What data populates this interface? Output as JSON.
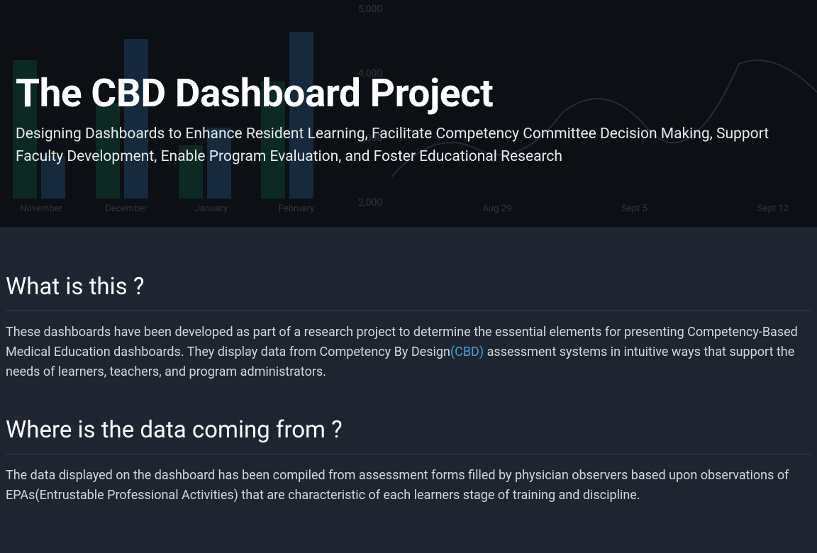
{
  "hero": {
    "title": "The CBD Dashboard Project",
    "subtitle": "Designing Dashboards to Enhance Resident Learning, Facilitate Competency Committee Decision Making, Support Faculty Development, Enable Program Evaluation, and Foster Educational Research"
  },
  "bgChart": {
    "months": [
      "November",
      "December",
      "January",
      "February"
    ],
    "yTicks": [
      "5,000",
      "4,000",
      "3,000",
      "2,000"
    ],
    "dates": [
      "Aug 29",
      "Sept 5",
      "Sept 12"
    ]
  },
  "sections": {
    "whatIsThis": {
      "title": "What is this ?",
      "textBefore": "These dashboards have been developed as part of a research project to determine the essential elements for presenting Competency-Based Medical Education dashboards. They display data from Competency By Design",
      "linkText": "(CBD)",
      "textAfter": " assessment systems in intuitive ways that support the needs of learners, teachers, and program administrators."
    },
    "whereData": {
      "title": "Where is the data coming from ?",
      "text": "The data displayed on the dashboard has been compiled from assessment forms filled by physician observers based upon observations of EPAs(Entrustable Professional Activities) that are characteristic of each learners stage of training and discipline."
    }
  }
}
